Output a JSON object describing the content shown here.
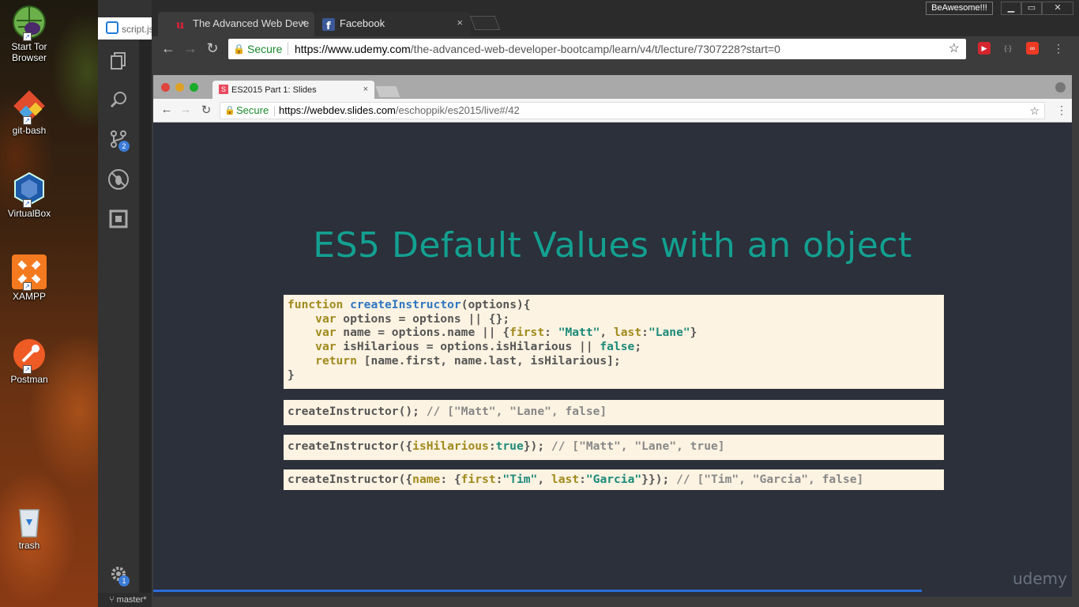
{
  "desktop": {
    "icons": [
      {
        "label_line1": "Start Tor",
        "label_line2": "Browser"
      },
      {
        "label_line1": "git-bash",
        "label_line2": ""
      },
      {
        "label_line1": "VirtualBox",
        "label_line2": ""
      },
      {
        "label_line1": "XAMPP",
        "label_line2": ""
      },
      {
        "label_line1": "Postman",
        "label_line2": ""
      },
      {
        "label_line1": "trash",
        "label_line2": ""
      }
    ]
  },
  "vscode": {
    "tab_label": "script.js",
    "scm_badge": "2",
    "settings_badge": "1",
    "branch": "master*"
  },
  "browser": {
    "tabs": [
      {
        "title": "The Advanced Web Deve",
        "close": "×"
      },
      {
        "title": "Facebook",
        "close": "×"
      }
    ],
    "profile": "BeAwesome!!!",
    "window_controls": {
      "minimize": "▁",
      "maximize": "▭",
      "close": "✕"
    },
    "nav": {
      "back": "←",
      "forward": "→",
      "reload": "↻"
    },
    "address": {
      "secure": "Secure",
      "url_host": "https://www.udemy.com",
      "url_path": "/the-advanced-web-developer-bootcamp/learn/v4/t/lecture/7307228?start=0"
    }
  },
  "inner_browser": {
    "tab_title": "ES2015 Part 1: Slides",
    "tab_favicon": "S",
    "tab_close": "×",
    "address": {
      "secure": "Secure",
      "url_host": "https://webdev.slides.com",
      "url_path": "/eschoppik/es2015/live#/42"
    }
  },
  "slide": {
    "title": "ES5 Default Values with an object",
    "code_main": [
      {
        "kw": "function",
        "fn": "createInstructor",
        "rest": "(options){"
      },
      {
        "indent": "    ",
        "kw": "var",
        "rest": " options = options || {};"
      },
      {
        "indent": "    ",
        "kw": "var",
        "a": " name = options.name || {",
        "p1": "first",
        "b": ": ",
        "s1": "\"Matt\"",
        "c": ", ",
        "p2": "last",
        "d": ":",
        "s2": "\"Lane\"",
        "e": "}"
      },
      {
        "indent": "    ",
        "kw": "var",
        "a": " isHilarious = options.isHilarious || ",
        "bool": "false",
        "e": ";"
      },
      {
        "indent": "    ",
        "kw": "return",
        "rest": " [name.first, name.last, isHilarious];"
      },
      {
        "rest": "}"
      }
    ],
    "call1": {
      "code": "createInstructor(); ",
      "comment": "// [\"Matt\", \"Lane\", false]"
    },
    "call2": {
      "a": "createInstructor({",
      "prop": "isHilarious",
      "b": ":",
      "bool": "true",
      "c": "}); ",
      "comment": "// [\"Matt\", \"Lane\", true]"
    },
    "call3": {
      "a": "createInstructor({",
      "p1": "name",
      "b": ": {",
      "p2": "first",
      "c": ":",
      "s1": "\"Tim\"",
      "d": ", ",
      "p3": "last",
      "e": ":",
      "s2": "\"Garcia\"",
      "f": "}}); ",
      "comment": "// [\"Tim\", \"Garcia\", false]"
    },
    "progress": 0.837,
    "brand": "udemy",
    "nav_prev": "<",
    "nav_next": ">"
  }
}
